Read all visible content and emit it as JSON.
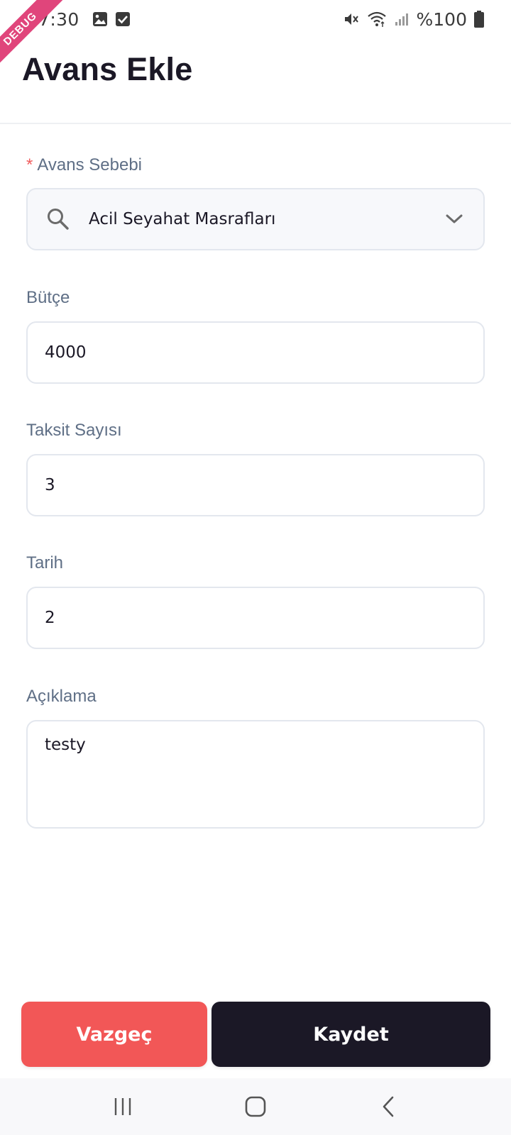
{
  "status_bar": {
    "time": "17:30",
    "battery_text": "%100",
    "icons": [
      "image-icon",
      "check-square-icon",
      "mute-icon",
      "wifi-icon",
      "signal-icon",
      "battery-icon"
    ]
  },
  "debug_ribbon": "DEBUG",
  "header": {
    "title": "Avans Ekle"
  },
  "form": {
    "reason": {
      "required_mark": "*",
      "label": "Avans Sebebi",
      "value": "Acil Seyahat Masrafları",
      "icon": "search-icon",
      "dropdown_icon": "chevron-down-icon"
    },
    "budget": {
      "label": "Bütçe",
      "value": "4000"
    },
    "installments": {
      "label": "Taksit Sayısı",
      "value": "3"
    },
    "date": {
      "label": "Tarih",
      "value": "2"
    },
    "description": {
      "label": "Açıklama",
      "value": "testy"
    }
  },
  "actions": {
    "cancel_label": "Vazgeç",
    "save_label": "Kaydet"
  },
  "colors": {
    "primary": "#1b1826",
    "danger": "#f25757",
    "label": "#5f6f86",
    "border": "#e3e7ee",
    "ribbon": "#e0457b"
  },
  "nav_bar": {
    "icons": [
      "recent-apps-icon",
      "home-icon",
      "back-icon"
    ]
  }
}
